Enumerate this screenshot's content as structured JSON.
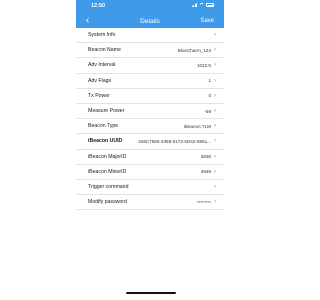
{
  "status": {
    "time": "12:50"
  },
  "nav": {
    "back": "‹",
    "title": "Details",
    "save": "Save"
  },
  "rows": [
    {
      "label": "System Info",
      "value": "",
      "bold": false
    },
    {
      "label": "Beacon Name",
      "value": "BlueCharm_124",
      "bold": false
    },
    {
      "label": "Adv Interval",
      "value": "1022.5",
      "bold": false
    },
    {
      "label": "Adv Flags",
      "value": "1",
      "bold": false
    },
    {
      "label": "Tx Power",
      "value": "0",
      "bold": false
    },
    {
      "label": "Measure Power",
      "value": "-59",
      "bold": false
    },
    {
      "label": "Beacon Type",
      "value": "iBeacon,TLM",
      "bold": false
    },
    {
      "label": "iBeacon UUID",
      "value": "426C7565-4368-6172-6D42-6561...",
      "bold": true
    },
    {
      "label": "iBeacon MajorID",
      "value": "3838",
      "bold": false
    },
    {
      "label": "iBeacon MinorID",
      "value": "4949",
      "bold": false
    },
    {
      "label": "Trigger command",
      "value": "",
      "bold": false
    },
    {
      "label": "Modify password",
      "value": "********",
      "bold": false
    }
  ],
  "chevron": "›"
}
